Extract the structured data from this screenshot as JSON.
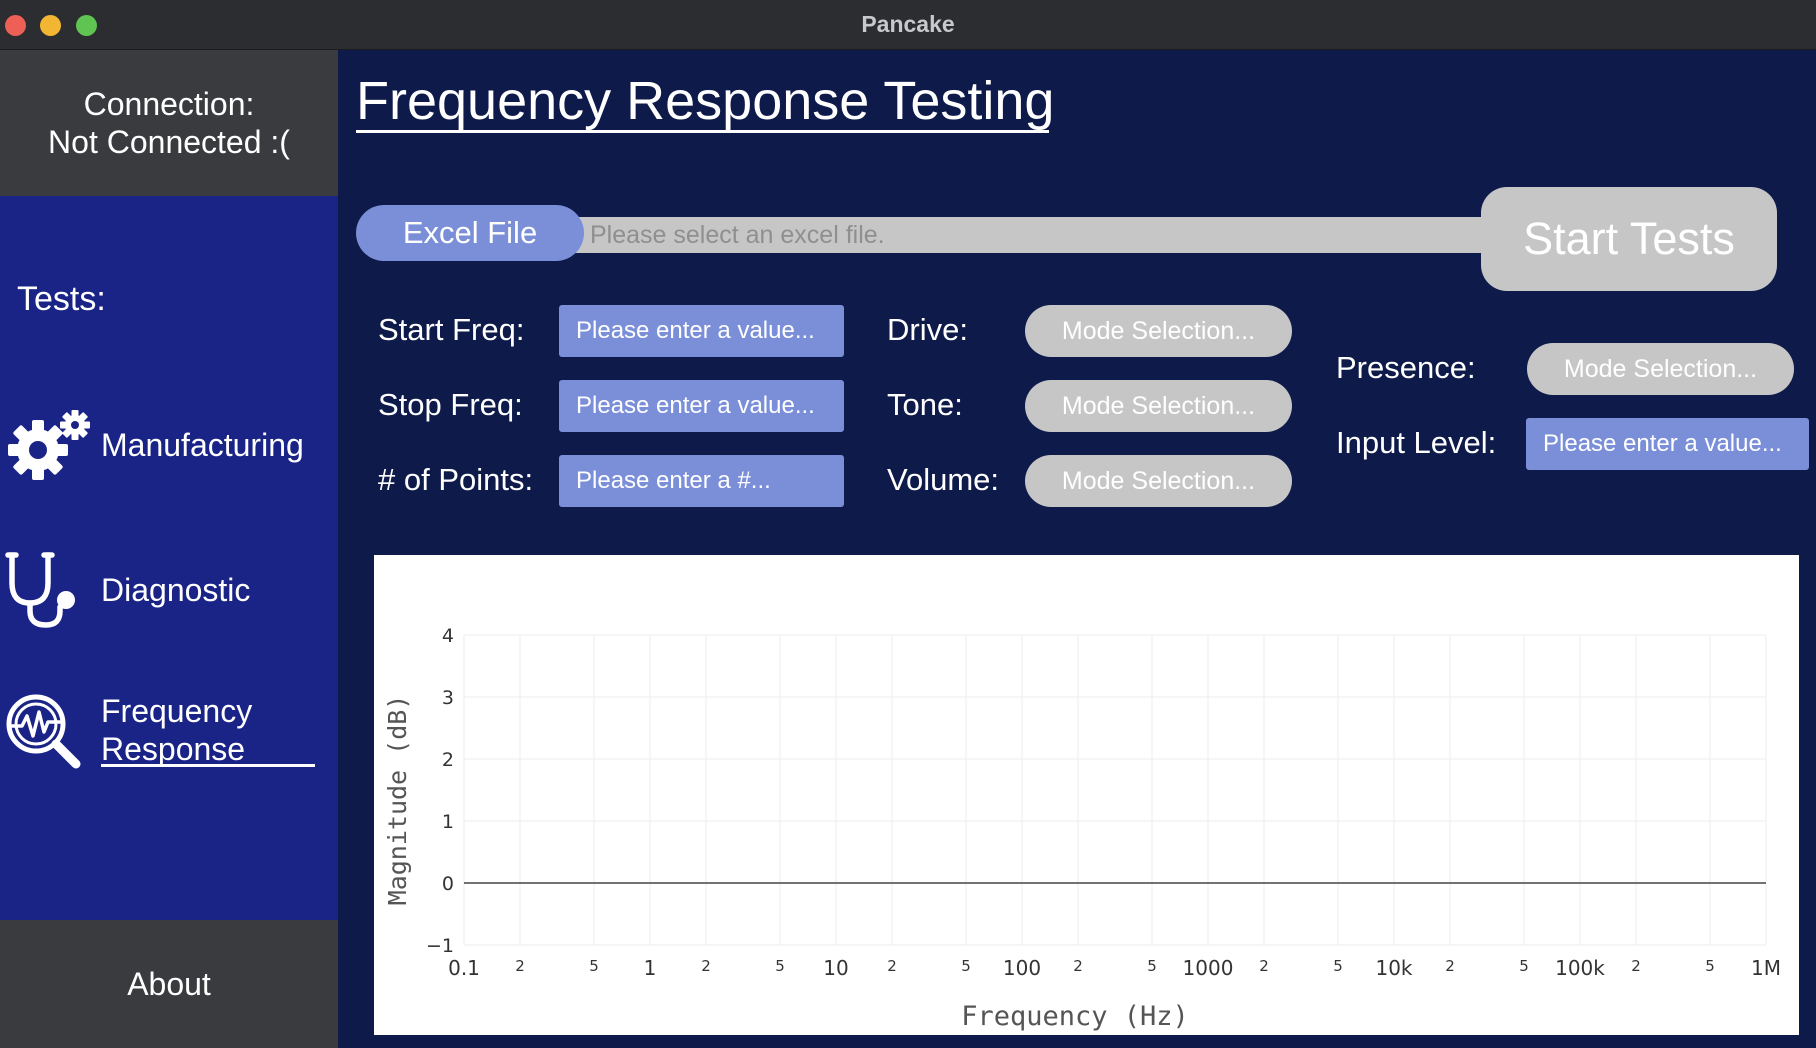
{
  "window": {
    "title": "Pancake"
  },
  "sidebar": {
    "connection_line1": "Connection:",
    "connection_line2": "Not Connected :(",
    "tests_label": "Tests:",
    "items": [
      {
        "label": "Manufacturing",
        "icon": "gears-icon"
      },
      {
        "label_line1": "Diagnostic",
        "icon": "stethoscope-icon"
      },
      {
        "label_line1": "Frequency",
        "label_line2": "Response",
        "icon": "frequency-search-icon",
        "active": true
      }
    ],
    "about_label": "About"
  },
  "main": {
    "title": "Frequency Response Testing",
    "excel_button": "Excel File",
    "file_placeholder": "Please select an excel file.",
    "start_button": "Start Tests",
    "fields": {
      "start_freq": {
        "label": "Start Freq:",
        "placeholder": "Please enter a value..."
      },
      "stop_freq": {
        "label": "Stop Freq:",
        "placeholder": "Please enter a value..."
      },
      "num_points": {
        "label": "# of Points:",
        "placeholder": "Please enter a #..."
      },
      "drive": {
        "label": "Drive:",
        "value": "Mode Selection..."
      },
      "tone": {
        "label": "Tone:",
        "value": "Mode Selection..."
      },
      "volume": {
        "label": "Volume:",
        "value": "Mode Selection..."
      },
      "presence": {
        "label": "Presence:",
        "value": "Mode Selection..."
      },
      "input_level": {
        "label": "Input Level:",
        "placeholder": "Please enter a value..."
      }
    }
  },
  "colors": {
    "sidebar_bg": "#1a2487",
    "main_bg": "#0e1a4a",
    "panel_gray": "#3a3b3f",
    "accent_blue": "#7b8fd9",
    "button_gray": "#c6c6c6"
  },
  "chart_data": {
    "type": "line",
    "xscale": "log",
    "xlim": [
      0.1,
      1000000
    ],
    "ylim": [
      -1,
      4
    ],
    "xlabel": "Frequency (Hz)",
    "ylabel": "Magnitude (dB)",
    "x_major_ticks": [
      {
        "value": 0.1,
        "label": "0.1"
      },
      {
        "value": 1,
        "label": "1"
      },
      {
        "value": 10,
        "label": "10"
      },
      {
        "value": 100,
        "label": "100"
      },
      {
        "value": 1000,
        "label": "1000"
      },
      {
        "value": 10000,
        "label": "10k"
      },
      {
        "value": 100000,
        "label": "100k"
      },
      {
        "value": 1000000,
        "label": "1M"
      }
    ],
    "x_minor_ticks": [
      {
        "value": 0.2,
        "label": "2"
      },
      {
        "value": 0.5,
        "label": "5"
      },
      {
        "value": 2,
        "label": "2"
      },
      {
        "value": 5,
        "label": "5"
      },
      {
        "value": 20,
        "label": "2"
      },
      {
        "value": 50,
        "label": "5"
      },
      {
        "value": 200,
        "label": "2"
      },
      {
        "value": 500,
        "label": "5"
      },
      {
        "value": 2000,
        "label": "2"
      },
      {
        "value": 5000,
        "label": "5"
      },
      {
        "value": 20000,
        "label": "2"
      },
      {
        "value": 50000,
        "label": "5"
      },
      {
        "value": 200000,
        "label": "2"
      },
      {
        "value": 500000,
        "label": "5"
      }
    ],
    "y_ticks": [
      {
        "value": 4,
        "label": "4"
      },
      {
        "value": 3,
        "label": "3"
      },
      {
        "value": 2,
        "label": "2"
      },
      {
        "value": 1,
        "label": "1"
      },
      {
        "value": 0,
        "label": "0"
      },
      {
        "value": -1,
        "label": "−1"
      }
    ],
    "grid": true,
    "series": []
  }
}
